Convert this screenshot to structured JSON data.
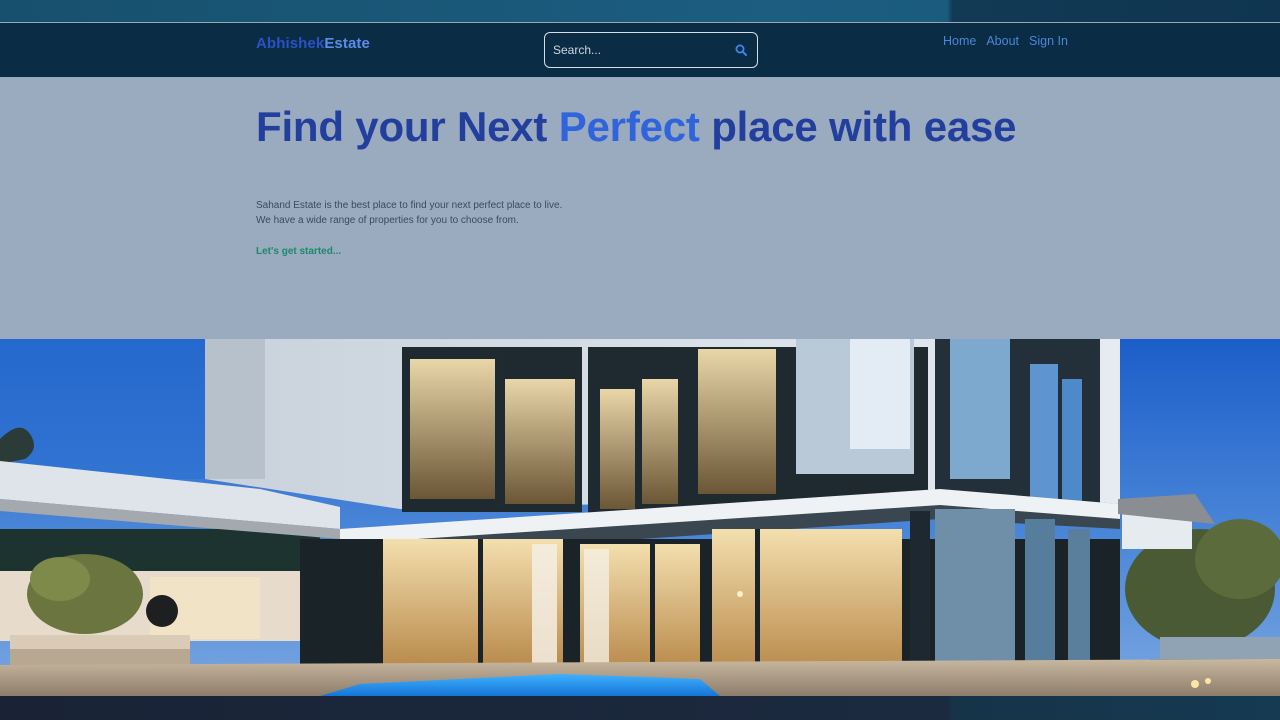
{
  "header": {
    "logo_part1": "Abhishek",
    "logo_part2": "Estate",
    "search_placeholder": "Search...",
    "nav": [
      "Home",
      "About",
      "Sign In"
    ]
  },
  "hero": {
    "title_start": "Find your Next ",
    "title_highlight": "Perfect",
    "title_end": " place with ease",
    "desc_line1": "Sahand Estate is the best place to find your next perfect place to live.",
    "desc_line2": "We have a wide range of properties for you to choose from.",
    "cta": "Let's get started..."
  },
  "colors": {
    "header_bg": "#0b2c45",
    "hero_bg": "#9aabbf",
    "title": "#233f9e",
    "highlight": "#2f64dc",
    "cta": "#1a8a6a",
    "nav_link": "#4b86d9"
  },
  "icons": {
    "search": "magnifier-icon"
  }
}
